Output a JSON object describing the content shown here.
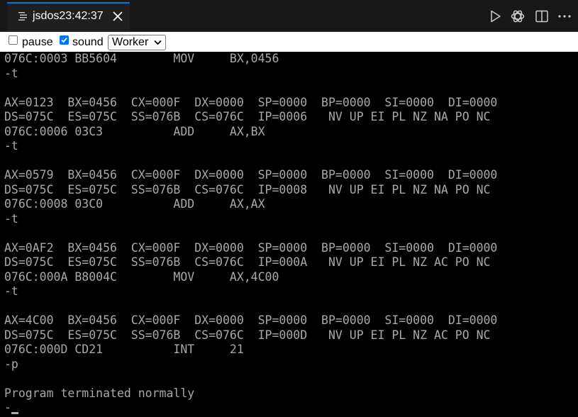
{
  "tab": {
    "title": "jsdos23:42:37",
    "icon": "document-lines-icon",
    "close_icon": "close-icon"
  },
  "title_actions": [
    {
      "name": "run",
      "icon": "play-icon"
    },
    {
      "name": "copilot",
      "icon": "openai-icon"
    },
    {
      "name": "split-editor",
      "icon": "split-editor-icon"
    },
    {
      "name": "more-actions",
      "icon": "ellipsis-icon"
    }
  ],
  "toolbar": {
    "pause_label": "pause",
    "pause_checked": false,
    "sound_label": "sound",
    "sound_checked": true,
    "worker_select_value": "Worker"
  },
  "terminal": {
    "lines": [
      "076C:0003 BB5604        MOV     BX,0456",
      "-t",
      "",
      "AX=0123  BX=0456  CX=000F  DX=0000  SP=0000  BP=0000  SI=0000  DI=0000",
      "DS=075C  ES=075C  SS=076B  CS=076C  IP=0006   NV UP EI PL NZ NA PO NC",
      "076C:0006 03C3          ADD     AX,BX",
      "-t",
      "",
      "AX=0579  BX=0456  CX=000F  DX=0000  SP=0000  BP=0000  SI=0000  DI=0000",
      "DS=075C  ES=075C  SS=076B  CS=076C  IP=0008   NV UP EI PL NZ NA PO NC",
      "076C:0008 03C0          ADD     AX,AX",
      "-t",
      "",
      "AX=0AF2  BX=0456  CX=000F  DX=0000  SP=0000  BP=0000  SI=0000  DI=0000",
      "DS=075C  ES=075C  SS=076B  CS=076C  IP=000A   NV UP EI PL NZ AC PO NC",
      "076C:000A B8004C        MOV     AX,4C00",
      "-t",
      "",
      "AX=4C00  BX=0456  CX=000F  DX=0000  SP=0000  BP=0000  SI=0000  DI=0000",
      "DS=075C  ES=075C  SS=076B  CS=076C  IP=000D   NV UP EI PL NZ AC PO NC",
      "076C:000D CD21          INT     21",
      "-p",
      "",
      "Program terminated normally",
      "-"
    ]
  },
  "colors": {
    "terminal_text": "#a8a8a8",
    "terminal_bg": "#000000",
    "tab_accent": "#0078d4",
    "titlebar_bg": "#181818",
    "checkbox_checked": "#0075ff"
  }
}
